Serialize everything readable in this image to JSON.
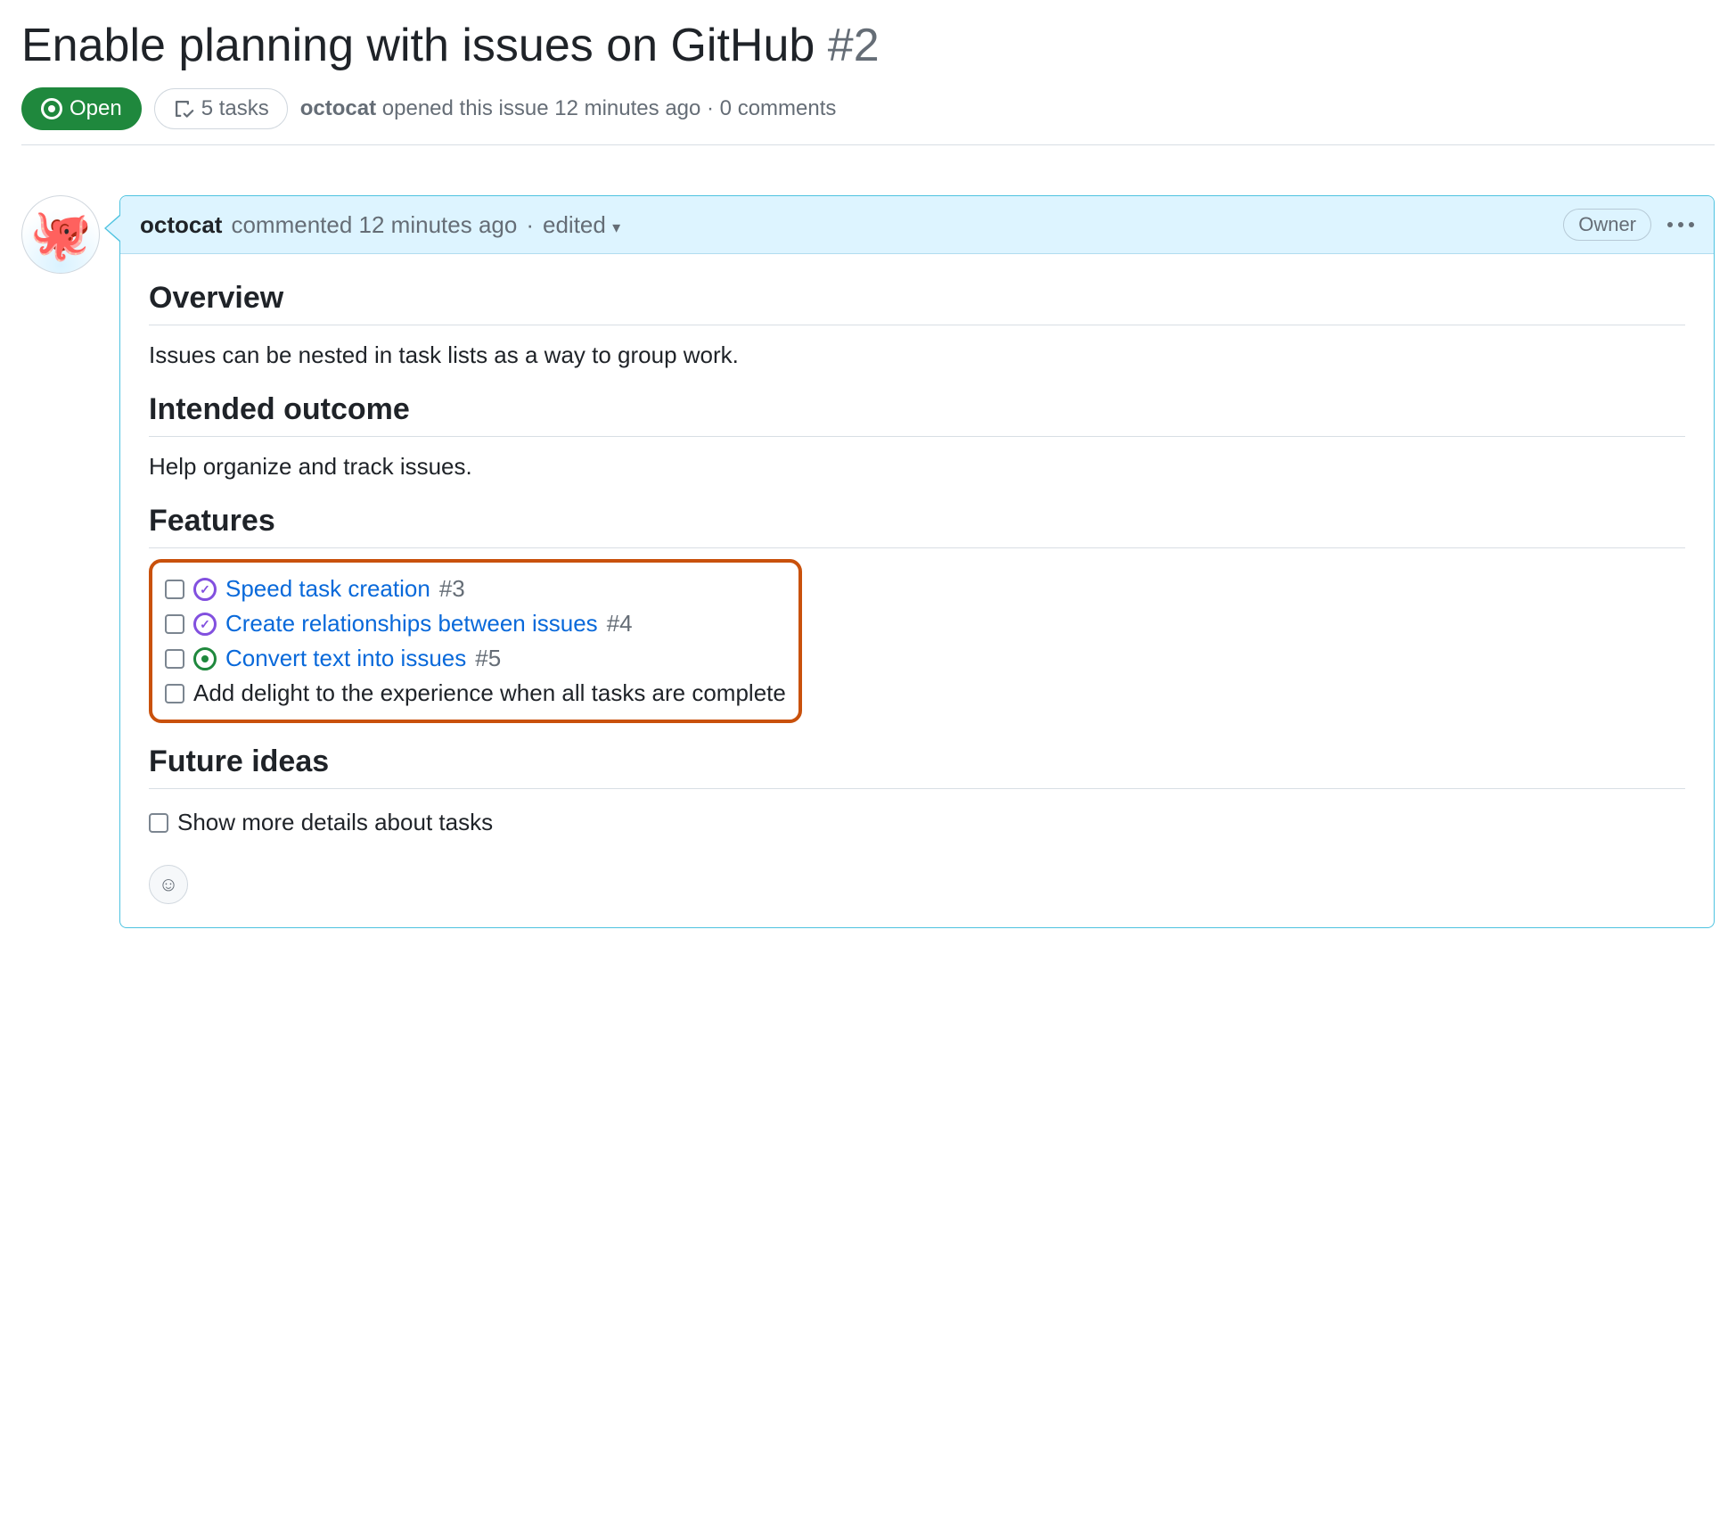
{
  "issue": {
    "title": "Enable planning with issues on GitHub",
    "number": "#2",
    "state_label": "Open",
    "tasks_count_label": "5 tasks",
    "author": "octocat",
    "opened_text": "opened this issue 12 minutes ago · 0 comments"
  },
  "comment": {
    "author": "octocat",
    "action_text": "commented 12 minutes ago",
    "sep": "·",
    "edited_label": "edited",
    "role_badge": "Owner",
    "avatar_emoji": "🐙"
  },
  "body": {
    "h_overview": "Overview",
    "p_overview": "Issues can be nested in task lists as a way to group work.",
    "h_outcome": "Intended outcome",
    "p_outcome": "Help organize and track issues.",
    "h_features": "Features",
    "features": [
      {
        "status": "closed",
        "link": "Speed task creation",
        "ref": "#3"
      },
      {
        "status": "closed",
        "link": "Create relationships between issues",
        "ref": "#4"
      },
      {
        "status": "open",
        "link": "Convert text into issues",
        "ref": "#5"
      },
      {
        "status": "none",
        "text": "Add delight to the experience when all tasks are complete"
      }
    ],
    "h_future": "Future ideas",
    "future": [
      {
        "status": "none",
        "text": "Show more details about tasks"
      }
    ],
    "reaction_emoji": "☺"
  }
}
